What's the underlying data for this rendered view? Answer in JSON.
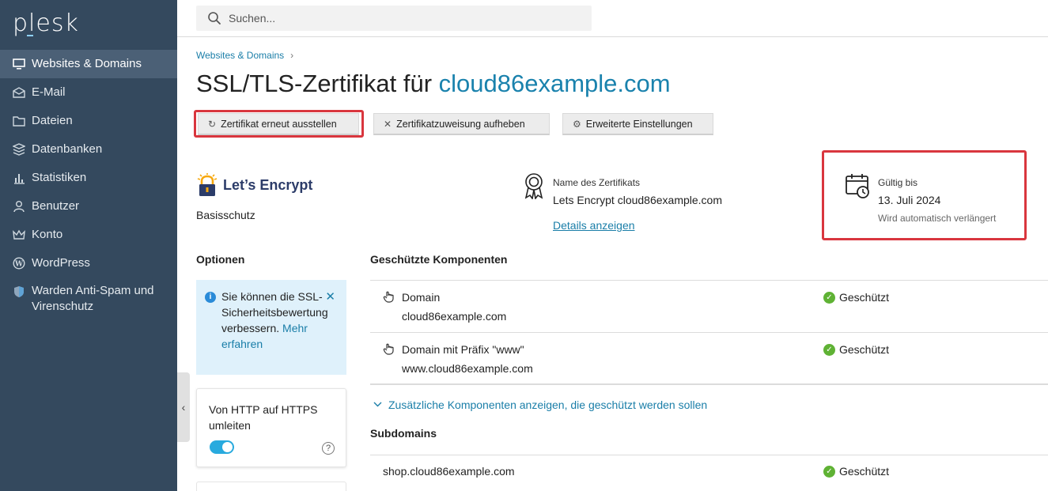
{
  "app": {
    "logo": "plesk"
  },
  "search": {
    "placeholder": "Suchen..."
  },
  "sidebar": {
    "items": [
      {
        "label": "Websites & Domains",
        "icon": "monitor-icon",
        "active": true
      },
      {
        "label": "E-Mail",
        "icon": "mail-icon"
      },
      {
        "label": "Dateien",
        "icon": "folder-icon"
      },
      {
        "label": "Datenbanken",
        "icon": "database-icon"
      },
      {
        "label": "Statistiken",
        "icon": "bar-chart-icon"
      },
      {
        "label": "Benutzer",
        "icon": "user-icon"
      },
      {
        "label": "Konto",
        "icon": "crown-icon"
      },
      {
        "label": "WordPress",
        "icon": "wordpress-icon"
      },
      {
        "label": "Warden Anti-Spam und Virenschutz",
        "icon": "shield-icon"
      }
    ]
  },
  "breadcrumb": {
    "item": "Websites & Domains"
  },
  "page": {
    "title_prefix": "SSL/TLS-Zertifikat für",
    "title_domain": "cloud86example.com"
  },
  "toolbar": {
    "reissue_label": "Zertifikat erneut ausstellen",
    "unassign_label": "Zertifikatzuweisung aufheben",
    "advanced_label": "Erweiterte Einstellungen"
  },
  "provider": {
    "name": "Let’s Encrypt",
    "plan": "Basisschutz"
  },
  "certificate": {
    "name_label": "Name des Zertifikats",
    "name": "Lets Encrypt cloud86example.com",
    "details_link": "Details anzeigen"
  },
  "validity": {
    "label": "Gültig bis",
    "date": "13. Juli 2024",
    "note": "Wird automatisch verlängert"
  },
  "options": {
    "title": "Optionen",
    "info_text": "Sie können die SSL-Sicherheitsbewertung verbessern.",
    "info_link": "Mehr erfahren",
    "redirect_label": "Von HTTP auf HTTPS umleiten",
    "redirect_enabled": true
  },
  "components": {
    "title": "Geschützte Komponenten",
    "rows": [
      {
        "name": "Domain",
        "value": "cloud86example.com",
        "status": "Geschützt"
      },
      {
        "name": "Domain mit Präfix \"www\"",
        "value": "www.cloud86example.com",
        "status": "Geschützt"
      }
    ],
    "show_more": "Zusätzliche Komponenten anzeigen, die geschützt werden sollen"
  },
  "subdomains": {
    "title": "Subdomains",
    "rows": [
      {
        "name": "shop.cloud86example.com",
        "status": "Geschützt"
      }
    ]
  },
  "colors": {
    "sidebar": "#34495e",
    "accent": "#1a82ad",
    "highlight": "#d9363e",
    "success": "#5fb234"
  }
}
